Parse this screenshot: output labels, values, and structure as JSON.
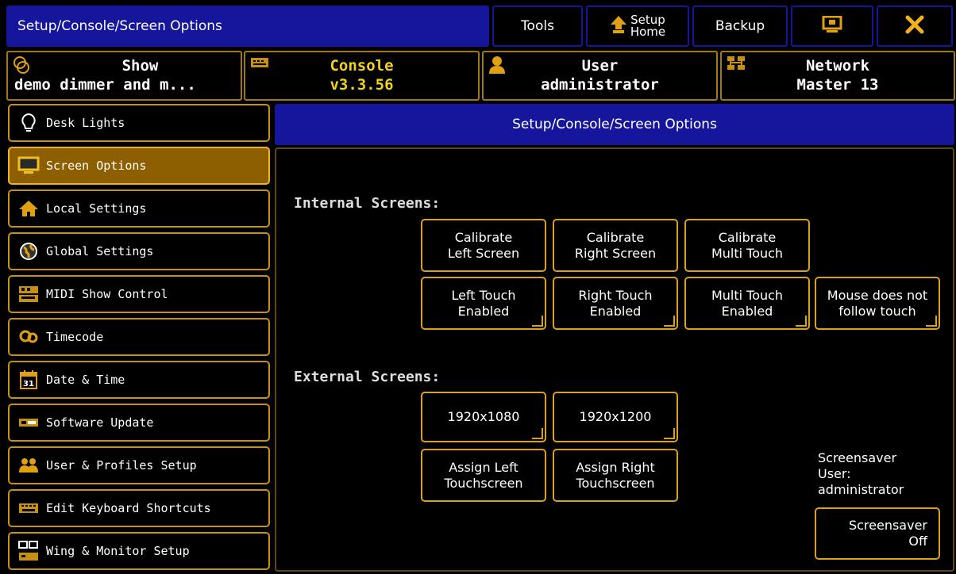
{
  "titlebar": {
    "title": "Setup/Console/Screen Options",
    "tools": "Tools",
    "setup_home_line1": "Setup",
    "setup_home_line2": "Home",
    "backup": "Backup"
  },
  "tabs": {
    "show_title": "Show",
    "show_value": "demo dimmer and m...",
    "console_title": "Console",
    "console_value": "v3.3.56",
    "user_title": "User",
    "user_value": "administrator",
    "network_title": "Network",
    "network_value": "Master 13"
  },
  "sidebar": {
    "items": [
      {
        "label": "Desk Lights",
        "icon": "lightbulb-icon"
      },
      {
        "label": "Screen Options",
        "icon": "monitor-icon",
        "active": true
      },
      {
        "label": "Local Settings",
        "icon": "house-icon"
      },
      {
        "label": "Global Settings",
        "icon": "globe-icon"
      },
      {
        "label": "MIDI Show Control",
        "icon": "midi-icon"
      },
      {
        "label": "Timecode",
        "icon": "timecode-icon"
      },
      {
        "label": "Date & Time",
        "icon": "calendar-icon"
      },
      {
        "label": "Software Update",
        "icon": "usb-icon"
      },
      {
        "label": "User & Profiles Setup",
        "icon": "users-icon"
      },
      {
        "label": "Edit Keyboard Shortcuts",
        "icon": "keyboard-icon"
      },
      {
        "label": "Wing & Monitor Setup",
        "icon": "wing-monitor-icon"
      }
    ]
  },
  "main": {
    "header": "Setup/Console/Screen Options",
    "internal_label": "Internal Screens:",
    "external_label": "External Screens:",
    "calibrate_left": [
      "Calibrate",
      "Left Screen"
    ],
    "calibrate_right": [
      "Calibrate",
      "Right Screen"
    ],
    "calibrate_multi": [
      "Calibrate",
      "Multi Touch"
    ],
    "left_touch": [
      "Left Touch",
      "Enabled"
    ],
    "right_touch": [
      "Right Touch",
      "Enabled"
    ],
    "multi_touch": [
      "Multi Touch",
      "Enabled"
    ],
    "mouse_follow": [
      "Mouse does not",
      "follow touch"
    ],
    "res_1080": "1920x1080",
    "res_1200": "1920x1200",
    "assign_left": [
      "Assign Left",
      "Touchscreen"
    ],
    "assign_right": [
      "Assign Right",
      "Touchscreen"
    ],
    "screensaver_info": [
      "Screensaver",
      "User:",
      "administrator"
    ],
    "screensaver_btn": [
      "Screensaver",
      "Off"
    ]
  },
  "colors": {
    "title_blue": "#16169c",
    "accent_gold": "#d9a21a",
    "console_yellow": "#f2d21a",
    "active_bg": "#8e5f00"
  }
}
